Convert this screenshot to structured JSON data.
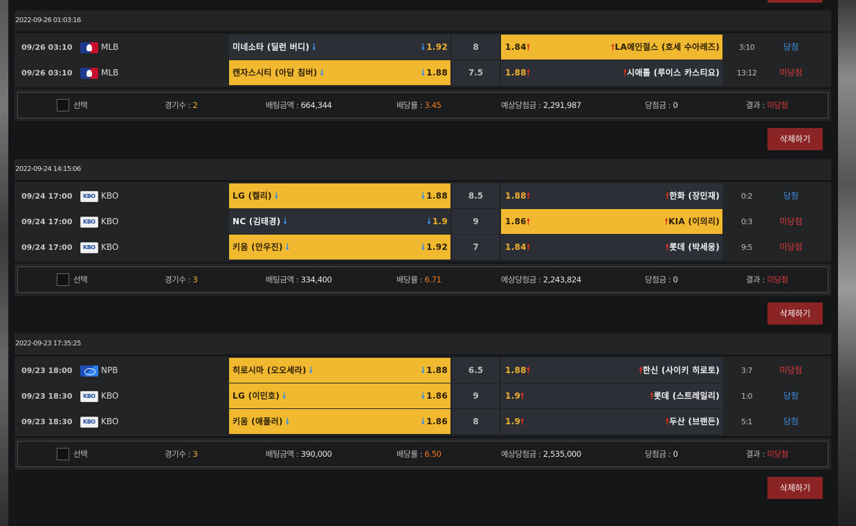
{
  "labels": {
    "select": "선택",
    "games": "경기수 : ",
    "bet_amount": "배팅금액 : ",
    "odds": "배당률 : ",
    "expected": "예상당첨금 : ",
    "win_amount": "당첨금 : ",
    "result": "결과 : ",
    "delete": "삭제하기"
  },
  "sections": [
    {
      "date": "2022-09-26 01:03:16",
      "rows": [
        {
          "time": "09/26 03:10",
          "league_icon": "mlb-logo-icon",
          "league": "MLB",
          "home": "미네소타 (딜런 버디)",
          "home_odds": "1.92",
          "draw": "8",
          "away_odds": "1.84",
          "away": "LA에인절스 (호세 수아레즈)",
          "score": "3:10",
          "result": "당첨",
          "pick": "away"
        },
        {
          "time": "09/26 03:10",
          "league_icon": "mlb-logo-icon",
          "league": "MLB",
          "home": "캔자스시티 (아담 침버)",
          "home_odds": "1.88",
          "draw": "7.5",
          "away_odds": "1.88",
          "away": "시애틀 (루이스 카스티요)",
          "score": "13:12",
          "result": "미당첨",
          "pick": "home"
        }
      ],
      "summary": {
        "games": "2",
        "bet": "664,344",
        "odds": "3.45",
        "expected": "2,291,987",
        "win": "0",
        "result": "미당첨"
      }
    },
    {
      "date": "2022-09-24 14:15:06",
      "rows": [
        {
          "time": "09/24 17:00",
          "league_icon": "kbo-logo-icon",
          "league": "KBO",
          "home": "LG (켈리)",
          "home_odds": "1.88",
          "draw": "8.5",
          "away_odds": "1.88",
          "away": "한화 (장민재)",
          "score": "0:2",
          "result": "당첨",
          "pick": "home"
        },
        {
          "time": "09/24 17:00",
          "league_icon": "kbo-logo-icon",
          "league": "KBO",
          "home": "NC (김태경)",
          "home_odds": "1.9",
          "draw": "9",
          "away_odds": "1.86",
          "away": "KIA (이의리)",
          "score": "0:3",
          "result": "미당첨",
          "pick": "away"
        },
        {
          "time": "09/24 17:00",
          "league_icon": "kbo-logo-icon",
          "league": "KBO",
          "home": "키움 (안우진)",
          "home_odds": "1.92",
          "draw": "7",
          "away_odds": "1.84",
          "away": "롯데 (박세웅)",
          "score": "9:5",
          "result": "미당첨",
          "pick": "home"
        }
      ],
      "summary": {
        "games": "3",
        "bet": "334,400",
        "odds": "6.71",
        "expected": "2,243,824",
        "win": "0",
        "result": "미당첨"
      }
    },
    {
      "date": "2022-09-23 17:35:25",
      "rows": [
        {
          "time": "09/23 18:00",
          "league_icon": "npb-logo-icon",
          "league": "NPB",
          "home": "히로시마 (오오세라)",
          "home_odds": "1.88",
          "draw": "6.5",
          "away_odds": "1.88",
          "away": "한신 (사이키 히로토)",
          "score": "3:7",
          "result": "미당첨",
          "pick": "home"
        },
        {
          "time": "09/23 18:30",
          "league_icon": "kbo-logo-icon",
          "league": "KBO",
          "home": "LG (이민호)",
          "home_odds": "1.86",
          "draw": "9",
          "away_odds": "1.9",
          "away": "롯데 (스트레일리)",
          "score": "1:0",
          "result": "당첨",
          "pick": "home"
        },
        {
          "time": "09/23 18:30",
          "league_icon": "kbo-logo-icon",
          "league": "KBO",
          "home": "키움 (애플러)",
          "home_odds": "1.86",
          "draw": "8",
          "away_odds": "1.9",
          "away": "두산 (브랜든)",
          "score": "5:1",
          "result": "당첨",
          "pick": "home"
        }
      ],
      "summary": {
        "games": "3",
        "bet": "390,000",
        "odds": "6.50",
        "expected": "2,535,000",
        "win": "0",
        "result": "미당첨"
      }
    }
  ]
}
